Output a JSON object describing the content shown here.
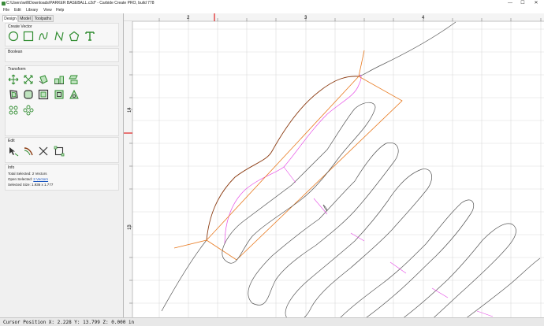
{
  "window": {
    "title": "C:\\Users\\will\\Downloads\\PARKER BASEBALL.c2d* - Carbide Create PRO, build 778",
    "minimize_glyph": "—",
    "maximize_glyph": "☐",
    "close_glyph": "✕"
  },
  "menu": {
    "file": "File",
    "edit": "Edit",
    "library": "Library",
    "view": "View",
    "help": "Help"
  },
  "tabs": {
    "design": "Design",
    "model": "Model",
    "toolpaths": "Toolpaths"
  },
  "sections": {
    "create_vector": "Create Vector",
    "boolean": "Boolean",
    "transform": "Transform",
    "edit": "Edit",
    "info": "Info"
  },
  "tools": {
    "create_vector": [
      "circle-icon",
      "rectangle-icon",
      "curve-icon",
      "polyline-icon",
      "polygon-icon",
      "text-icon"
    ],
    "transform_row1": [
      "move-icon",
      "scale-icon",
      "rotate-icon",
      "align-icon",
      "mirror-icon"
    ],
    "transform_row2": [
      "offset-icon",
      "fillet-icon",
      "inset-icon",
      "outline-icon",
      "weld-icon"
    ],
    "transform_row3": [
      "array-icon",
      "circular-array-icon"
    ],
    "edit": [
      "node-edit-icon",
      "trim-icon",
      "cut-icon",
      "boundary-icon"
    ]
  },
  "info": {
    "total_selected_label": "Total Selected:",
    "total_selected_value": "2 Vectors",
    "open_selected_label": "Open Selected:",
    "open_selected_value": "2 Vectors",
    "selected_size_label": "Selected Size:",
    "selected_size_value": "1.936 x 1.777"
  },
  "ruler": {
    "x_labels": [
      "2",
      "3",
      "4"
    ],
    "y_labels": [
      "14",
      "13"
    ]
  },
  "status": {
    "cursor": "Cursor Position X: 2.228 Y: 13.799 Z: 0.000 in"
  },
  "colors": {
    "accent_green": "#2e8b2e",
    "selection_orange": "#e87a20",
    "toolpath_magenta": "#e64ae6",
    "vector_gray": "#555555",
    "selected_brown": "#8a3a10"
  }
}
